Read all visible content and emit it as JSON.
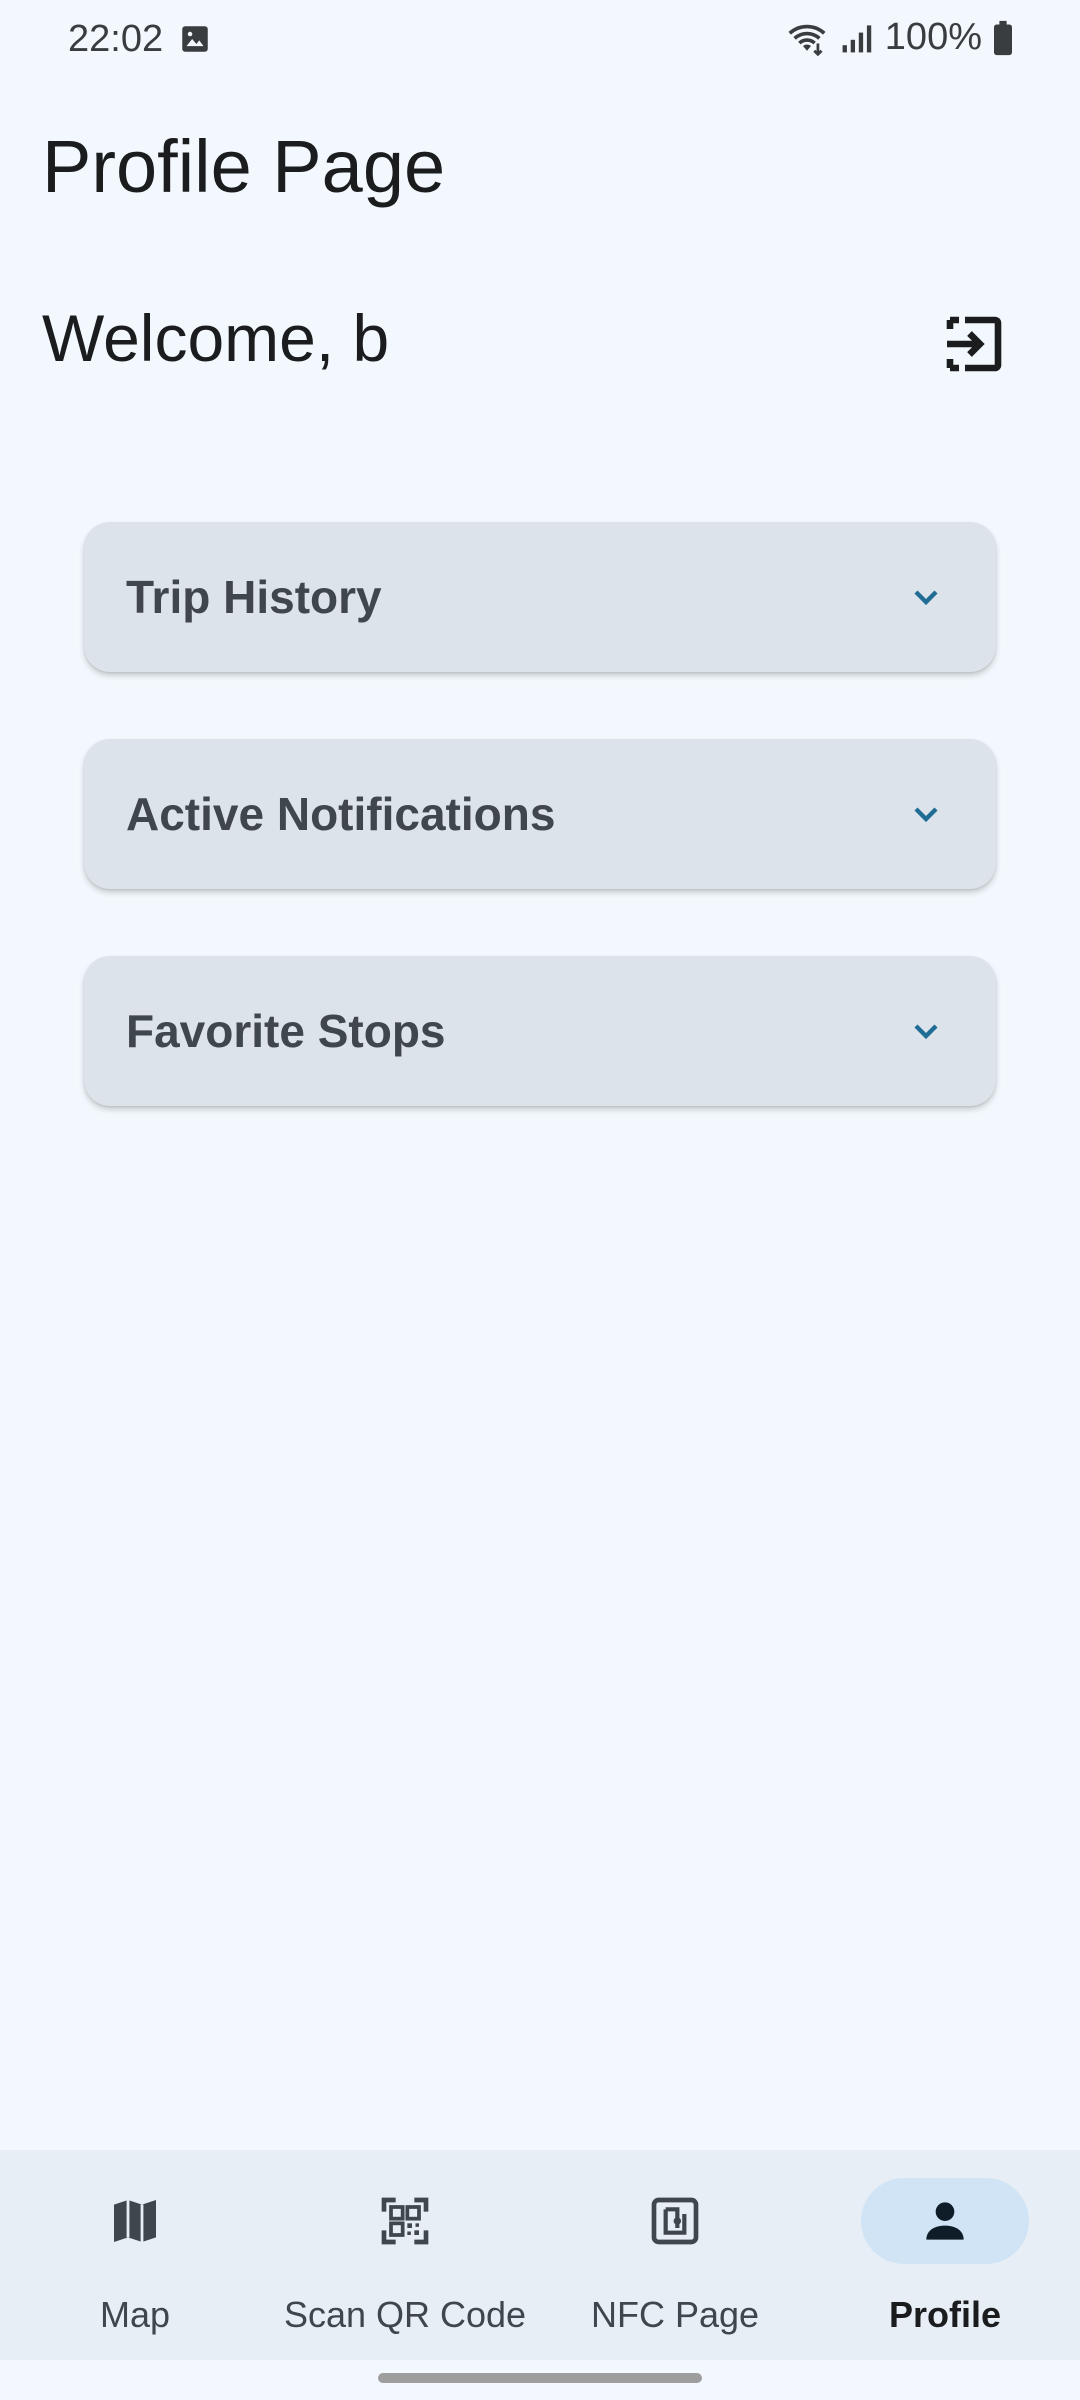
{
  "status_bar": {
    "time": "22:02",
    "battery_text": "100%",
    "icons": [
      "image-icon",
      "wifi-icon",
      "signal-icon",
      "battery-icon"
    ]
  },
  "page": {
    "title": "Profile Page",
    "welcome": "Welcome, b",
    "logout_icon": "logout-icon"
  },
  "sections": [
    {
      "label": "Trip History",
      "icon": "chevron-down-icon"
    },
    {
      "label": "Active Notifications",
      "icon": "chevron-down-icon"
    },
    {
      "label": "Favorite Stops",
      "icon": "chevron-down-icon"
    }
  ],
  "bottom_nav": {
    "items": [
      {
        "label": "Map",
        "icon": "map-icon",
        "active": false
      },
      {
        "label": "Scan QR Code",
        "icon": "qr-code-icon",
        "active": false
      },
      {
        "label": "NFC Page",
        "icon": "nfc-icon",
        "active": false
      },
      {
        "label": "Profile",
        "icon": "person-icon",
        "active": true
      }
    ]
  },
  "colors": {
    "background": "#f2f8fd",
    "card": "#dde3ea",
    "accent": "#1f6d95",
    "nav_background": "#e7eef5",
    "nav_active_indicator": "#d0e4f5"
  }
}
